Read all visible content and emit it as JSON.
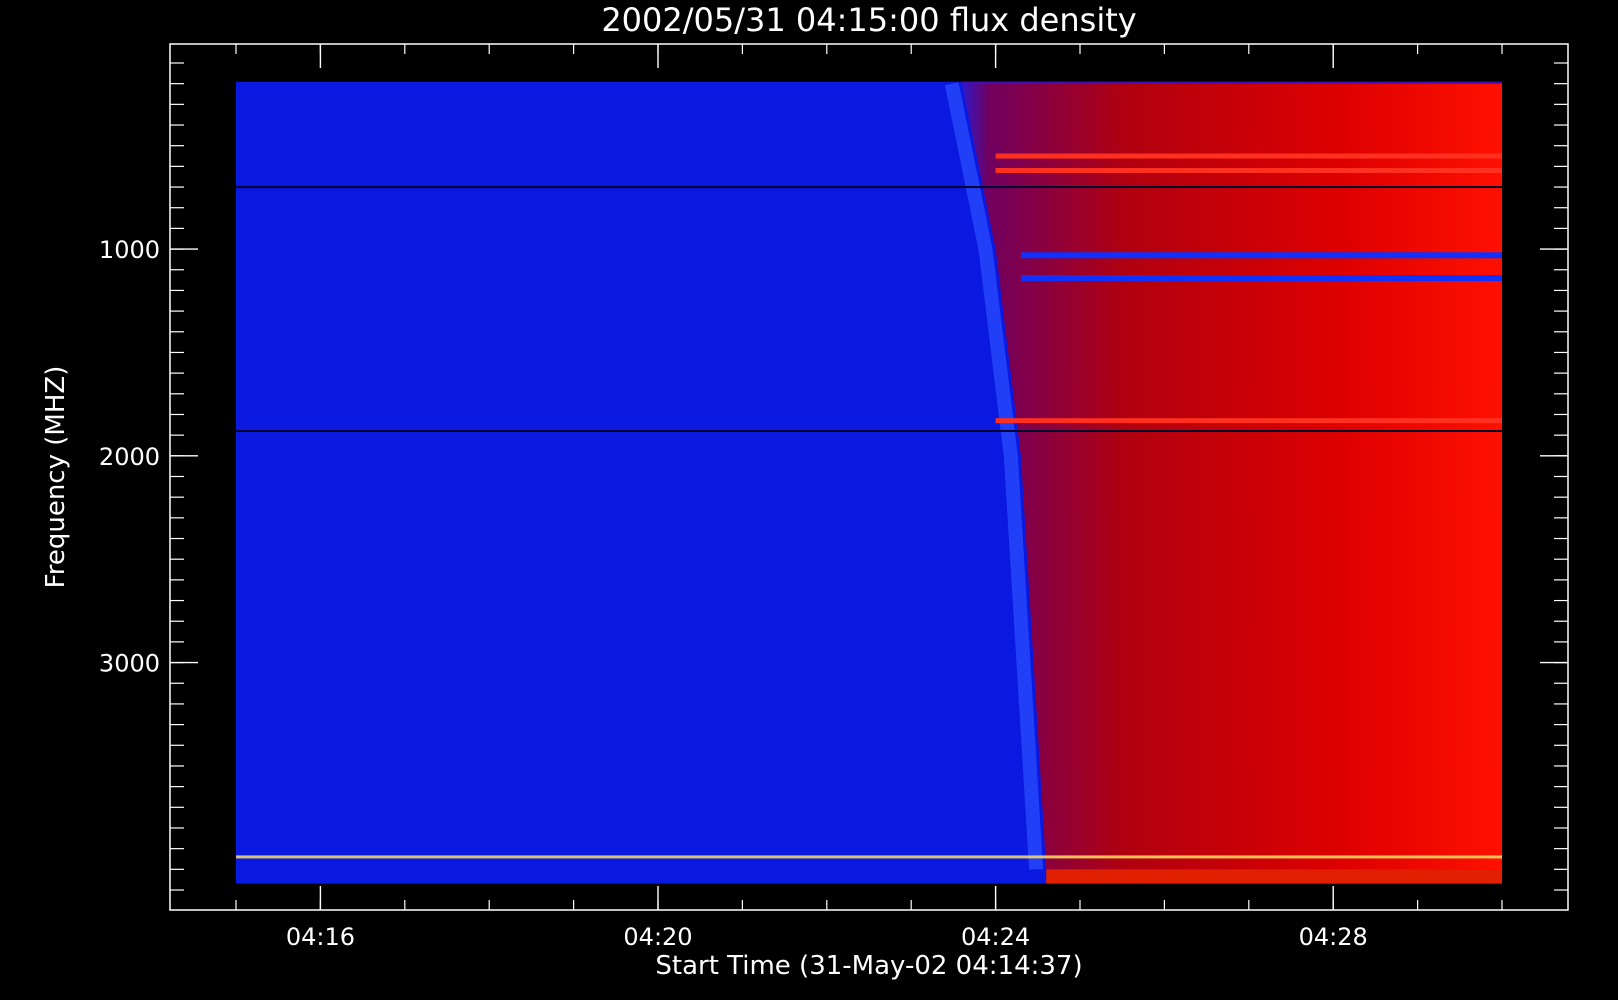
{
  "chart_data": {
    "type": "heatmap",
    "title": "2002/05/31 04:15:00 flux density",
    "xlabel": "Start Time (31-May-02 04:14:37)",
    "ylabel": "Frequency (MHZ)",
    "x_tick_labels": [
      "04:16",
      "04:20",
      "04:24",
      "04:28"
    ],
    "x_tick_minutes": [
      16,
      20,
      24,
      28
    ],
    "x_minor_minutes": [
      15,
      16,
      17,
      18,
      19,
      20,
      21,
      22,
      23,
      24,
      25,
      26,
      27,
      28,
      29,
      30
    ],
    "xlim_minutes": [
      15,
      30
    ],
    "y_tick_labels": [
      "1000",
      "2000",
      "3000"
    ],
    "y_tick_values": [
      1000,
      2000,
      3000
    ],
    "ylim": [
      100,
      4100
    ],
    "y_inverted": true,
    "y_minor_step": 100,
    "data_xlim_minutes": [
      15,
      30
    ],
    "data_ylim": [
      190,
      4070
    ],
    "onset_minute": 24.3,
    "onset_frequency_curve": [
      {
        "mhz": 200,
        "minute": 23.6
      },
      {
        "mhz": 1000,
        "minute": 24.0
      },
      {
        "mhz": 2000,
        "minute": 24.3
      },
      {
        "mhz": 3000,
        "minute": 24.45
      },
      {
        "mhz": 4000,
        "minute": 24.6
      }
    ],
    "colormap": [
      "#0000c8",
      "#2a00c0",
      "#6a0080",
      "#a00020",
      "#e00000",
      "#ff2000",
      "#ff8000",
      "#ffff00"
    ],
    "background_color": "#0a18e0",
    "notable_bands_mhz": [
      {
        "mhz": 550,
        "kind": "bright-line"
      },
      {
        "mhz": 620,
        "kind": "bright-line"
      },
      {
        "mhz": 700,
        "kind": "dark-line"
      },
      {
        "mhz": 1030,
        "kind": "blue-band"
      },
      {
        "mhz": 1140,
        "kind": "blue-band"
      },
      {
        "mhz": 1830,
        "kind": "bright-line"
      },
      {
        "mhz": 1880,
        "kind": "dark-line"
      },
      {
        "mhz": 3940,
        "kind": "yellow-line"
      }
    ],
    "grid": false
  }
}
